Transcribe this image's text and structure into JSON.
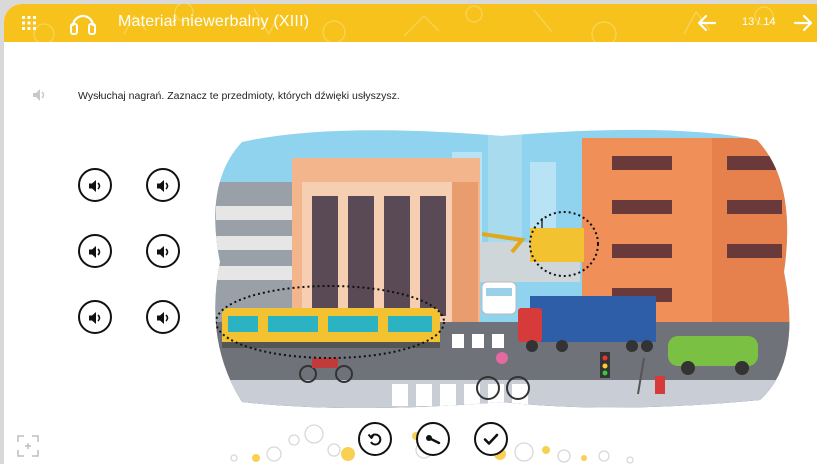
{
  "header": {
    "title": "Materiał niewerbalny (XIII)",
    "page_indicator": "13 / 14",
    "accent_color": "#f6c21b",
    "icons": [
      "grid-icon",
      "headphones-icon",
      "arrow-left-icon",
      "arrow-right-icon"
    ]
  },
  "instruction": {
    "text": "Wysłuchaj nagrań. Zaznacz te przedmioty, których  dźwięki usłyszysz.",
    "icon": "speaker-icon"
  },
  "sound_buttons": {
    "count": 6,
    "icon": "speaker-icon"
  },
  "scene": {
    "description_icon": "city-street-illustration",
    "selected_items": [
      "tram",
      "crane"
    ]
  },
  "controls": {
    "icons": [
      "reset-icon",
      "key-icon",
      "check-icon",
      "fullscreen-icon"
    ]
  }
}
